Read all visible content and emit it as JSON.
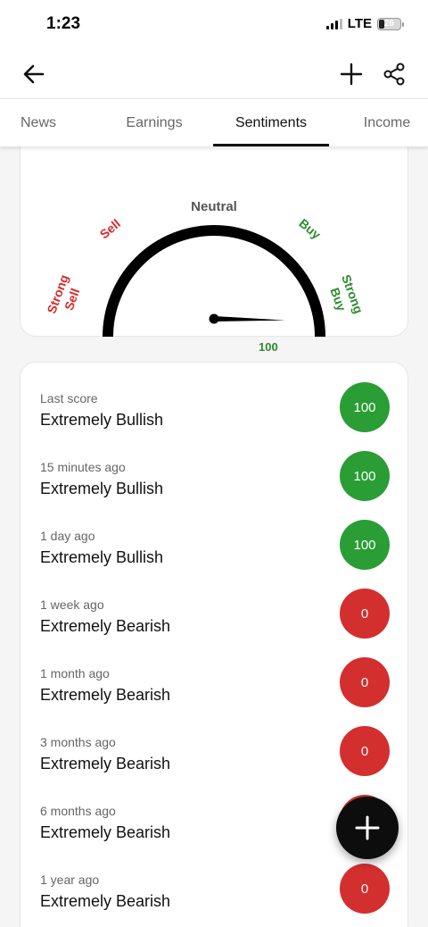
{
  "status_bar": {
    "time": "1:23",
    "network": "LTE",
    "battery_level": "26"
  },
  "header": {
    "back_icon": "arrow-left-icon",
    "add_icon": "plus-icon",
    "share_icon": "share-icon"
  },
  "tabs": [
    {
      "label": "News",
      "active": false
    },
    {
      "label": "Earnings",
      "active": false
    },
    {
      "label": "Sentiments",
      "active": true
    },
    {
      "label": "Income",
      "active": false
    }
  ],
  "gauge": {
    "labels": {
      "strong_sell": [
        "Strong",
        "Sell"
      ],
      "sell": "Sell",
      "neutral": "Neutral",
      "buy": "Buy",
      "strong_buy": [
        "Strong",
        "Buy"
      ]
    },
    "value": 100,
    "value_label": "100",
    "sell_color": "#d62b2b",
    "buy_color": "#2e8b2e",
    "neutral_color": "#555555"
  },
  "history": [
    {
      "time": "Last score",
      "label": "Extremely Bullish",
      "score": "100",
      "sentiment": "bullish"
    },
    {
      "time": "15 minutes ago",
      "label": "Extremely Bullish",
      "score": "100",
      "sentiment": "bullish"
    },
    {
      "time": "1 day ago",
      "label": "Extremely Bullish",
      "score": "100",
      "sentiment": "bullish"
    },
    {
      "time": "1 week ago",
      "label": "Extremely Bearish",
      "score": "0",
      "sentiment": "bearish"
    },
    {
      "time": "1 month ago",
      "label": "Extremely Bearish",
      "score": "0",
      "sentiment": "bearish"
    },
    {
      "time": "3 months ago",
      "label": "Extremely Bearish",
      "score": "0",
      "sentiment": "bearish"
    },
    {
      "time": "6 months ago",
      "label": "Extremely Bearish",
      "score": "0",
      "sentiment": "bearish"
    },
    {
      "time": "1 year ago",
      "label": "Extremely Bearish",
      "score": "0",
      "sentiment": "bearish"
    }
  ],
  "colors": {
    "bullish": "#2a9d35",
    "bearish": "#d32f2f",
    "fab": "#0d0d0d"
  },
  "fab": {
    "icon": "plus-icon"
  }
}
